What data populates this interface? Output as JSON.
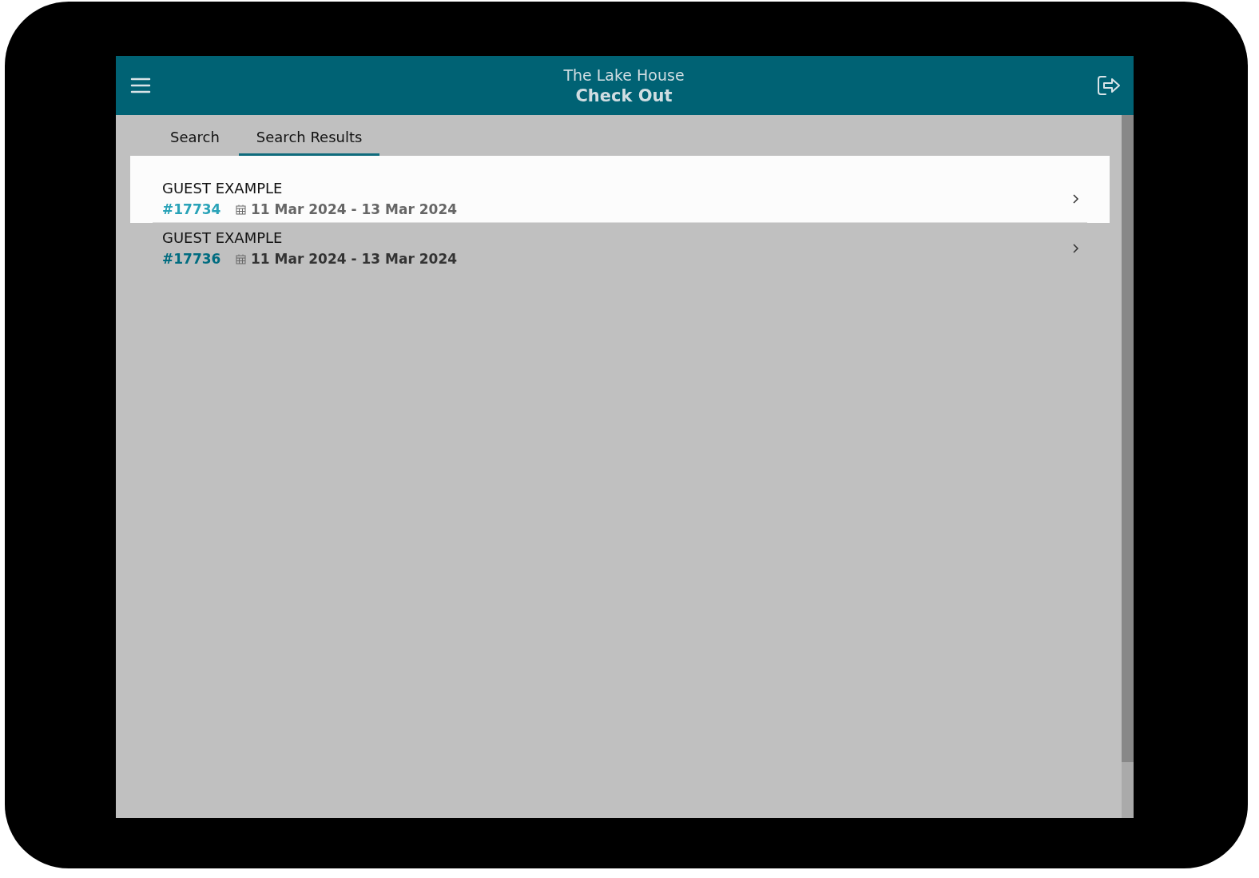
{
  "header": {
    "venue": "The Lake House",
    "title": "Check Out"
  },
  "tabs": [
    {
      "label": "Search",
      "selected": false
    },
    {
      "label": "Search Results",
      "selected": true
    }
  ],
  "results": [
    {
      "name": "GUEST EXAMPLE",
      "booking": "#17734",
      "dates": "11 Mar 2024 - 13 Mar 2024",
      "selected": true
    },
    {
      "name": "GUEST EXAMPLE",
      "booking": "#17736",
      "dates": "11 Mar 2024 - 13 Mar 2024",
      "selected": false
    }
  ]
}
